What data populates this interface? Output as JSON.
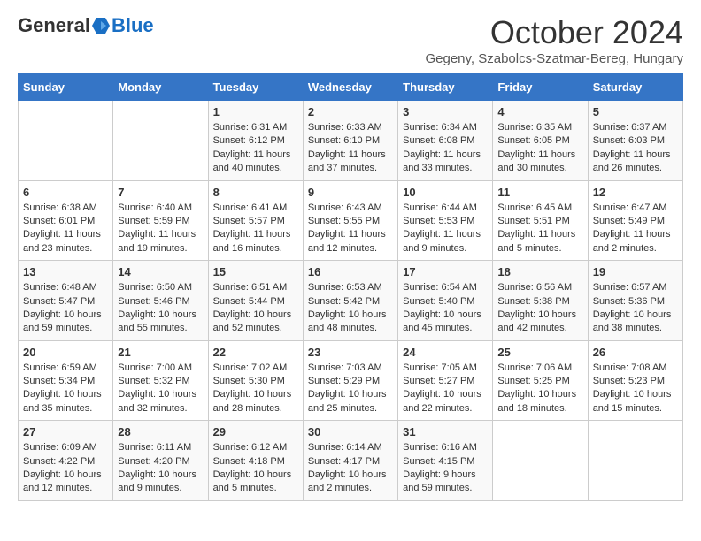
{
  "header": {
    "logo_general": "General",
    "logo_blue": "Blue",
    "month_title": "October 2024",
    "location": "Gegeny, Szabolcs-Szatmar-Bereg, Hungary"
  },
  "weekdays": [
    "Sunday",
    "Monday",
    "Tuesday",
    "Wednesday",
    "Thursday",
    "Friday",
    "Saturday"
  ],
  "weeks": [
    [
      null,
      null,
      {
        "day": 1,
        "sunrise": "6:31 AM",
        "sunset": "6:12 PM",
        "daylight": "11 hours and 40 minutes."
      },
      {
        "day": 2,
        "sunrise": "6:33 AM",
        "sunset": "6:10 PM",
        "daylight": "11 hours and 37 minutes."
      },
      {
        "day": 3,
        "sunrise": "6:34 AM",
        "sunset": "6:08 PM",
        "daylight": "11 hours and 33 minutes."
      },
      {
        "day": 4,
        "sunrise": "6:35 AM",
        "sunset": "6:05 PM",
        "daylight": "11 hours and 30 minutes."
      },
      {
        "day": 5,
        "sunrise": "6:37 AM",
        "sunset": "6:03 PM",
        "daylight": "11 hours and 26 minutes."
      }
    ],
    [
      {
        "day": 6,
        "sunrise": "6:38 AM",
        "sunset": "6:01 PM",
        "daylight": "11 hours and 23 minutes."
      },
      {
        "day": 7,
        "sunrise": "6:40 AM",
        "sunset": "5:59 PM",
        "daylight": "11 hours and 19 minutes."
      },
      {
        "day": 8,
        "sunrise": "6:41 AM",
        "sunset": "5:57 PM",
        "daylight": "11 hours and 16 minutes."
      },
      {
        "day": 9,
        "sunrise": "6:43 AM",
        "sunset": "5:55 PM",
        "daylight": "11 hours and 12 minutes."
      },
      {
        "day": 10,
        "sunrise": "6:44 AM",
        "sunset": "5:53 PM",
        "daylight": "11 hours and 9 minutes."
      },
      {
        "day": 11,
        "sunrise": "6:45 AM",
        "sunset": "5:51 PM",
        "daylight": "11 hours and 5 minutes."
      },
      {
        "day": 12,
        "sunrise": "6:47 AM",
        "sunset": "5:49 PM",
        "daylight": "11 hours and 2 minutes."
      }
    ],
    [
      {
        "day": 13,
        "sunrise": "6:48 AM",
        "sunset": "5:47 PM",
        "daylight": "10 hours and 59 minutes."
      },
      {
        "day": 14,
        "sunrise": "6:50 AM",
        "sunset": "5:46 PM",
        "daylight": "10 hours and 55 minutes."
      },
      {
        "day": 15,
        "sunrise": "6:51 AM",
        "sunset": "5:44 PM",
        "daylight": "10 hours and 52 minutes."
      },
      {
        "day": 16,
        "sunrise": "6:53 AM",
        "sunset": "5:42 PM",
        "daylight": "10 hours and 48 minutes."
      },
      {
        "day": 17,
        "sunrise": "6:54 AM",
        "sunset": "5:40 PM",
        "daylight": "10 hours and 45 minutes."
      },
      {
        "day": 18,
        "sunrise": "6:56 AM",
        "sunset": "5:38 PM",
        "daylight": "10 hours and 42 minutes."
      },
      {
        "day": 19,
        "sunrise": "6:57 AM",
        "sunset": "5:36 PM",
        "daylight": "10 hours and 38 minutes."
      }
    ],
    [
      {
        "day": 20,
        "sunrise": "6:59 AM",
        "sunset": "5:34 PM",
        "daylight": "10 hours and 35 minutes."
      },
      {
        "day": 21,
        "sunrise": "7:00 AM",
        "sunset": "5:32 PM",
        "daylight": "10 hours and 32 minutes."
      },
      {
        "day": 22,
        "sunrise": "7:02 AM",
        "sunset": "5:30 PM",
        "daylight": "10 hours and 28 minutes."
      },
      {
        "day": 23,
        "sunrise": "7:03 AM",
        "sunset": "5:29 PM",
        "daylight": "10 hours and 25 minutes."
      },
      {
        "day": 24,
        "sunrise": "7:05 AM",
        "sunset": "5:27 PM",
        "daylight": "10 hours and 22 minutes."
      },
      {
        "day": 25,
        "sunrise": "7:06 AM",
        "sunset": "5:25 PM",
        "daylight": "10 hours and 18 minutes."
      },
      {
        "day": 26,
        "sunrise": "7:08 AM",
        "sunset": "5:23 PM",
        "daylight": "10 hours and 15 minutes."
      }
    ],
    [
      {
        "day": 27,
        "sunrise": "6:09 AM",
        "sunset": "4:22 PM",
        "daylight": "10 hours and 12 minutes."
      },
      {
        "day": 28,
        "sunrise": "6:11 AM",
        "sunset": "4:20 PM",
        "daylight": "10 hours and 9 minutes."
      },
      {
        "day": 29,
        "sunrise": "6:12 AM",
        "sunset": "4:18 PM",
        "daylight": "10 hours and 5 minutes."
      },
      {
        "day": 30,
        "sunrise": "6:14 AM",
        "sunset": "4:17 PM",
        "daylight": "10 hours and 2 minutes."
      },
      {
        "day": 31,
        "sunrise": "6:16 AM",
        "sunset": "4:15 PM",
        "daylight": "9 hours and 59 minutes."
      },
      null,
      null
    ]
  ],
  "labels": {
    "sunrise": "Sunrise:",
    "sunset": "Sunset:",
    "daylight": "Daylight:"
  }
}
